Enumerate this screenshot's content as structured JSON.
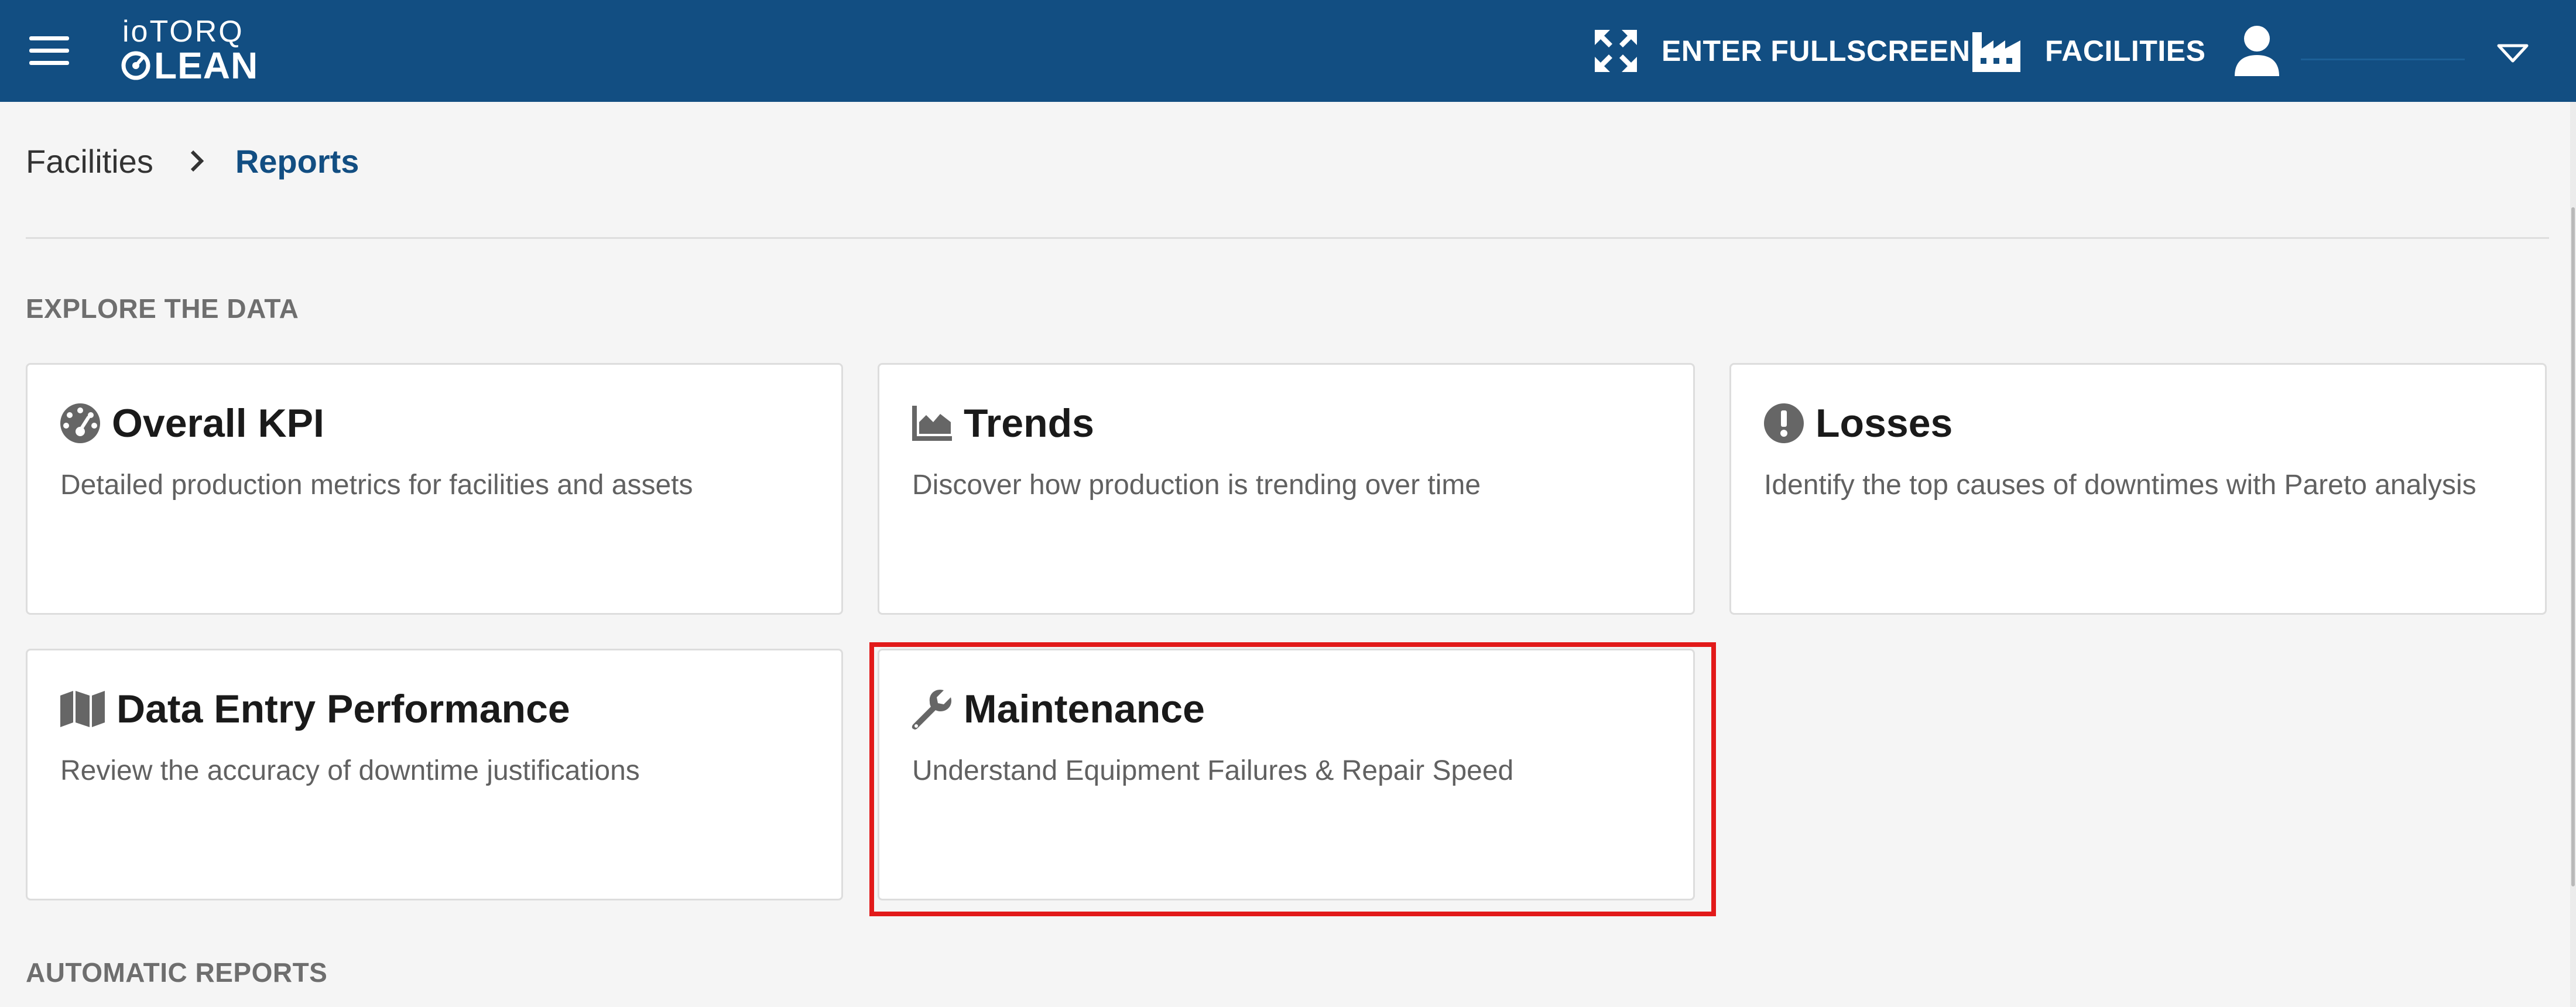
{
  "header": {
    "logo_top": "ioTORQ",
    "logo_bottom": "LEAN",
    "fullscreen_label": "ENTER FULLSCREEN",
    "facilities_label": "FACILITIES"
  },
  "breadcrumb": {
    "parent": "Facilities",
    "current": "Reports"
  },
  "sections": {
    "explore": "EXPLORE THE DATA",
    "automatic": "AUTOMATIC REPORTS"
  },
  "cards": [
    {
      "title": "Overall KPI",
      "description": "Detailed production metrics for facilities and assets",
      "icon": "dashboard-gauge-icon"
    },
    {
      "title": "Trends",
      "description": "Discover how production is trending over time",
      "icon": "area-chart-icon"
    },
    {
      "title": "Losses",
      "description": "Identify the top causes of downtimes with Pareto analysis",
      "icon": "exclamation-circle-icon"
    },
    {
      "title": "Data Entry Performance",
      "description": "Review the accuracy of downtime justifications",
      "icon": "map-icon"
    },
    {
      "title": "Maintenance",
      "description": "Understand Equipment Failures & Repair Speed",
      "icon": "wrench-icon"
    }
  ],
  "colors": {
    "header_bg": "#124e82",
    "accent": "#124e82",
    "highlight": "#e21a1a"
  }
}
